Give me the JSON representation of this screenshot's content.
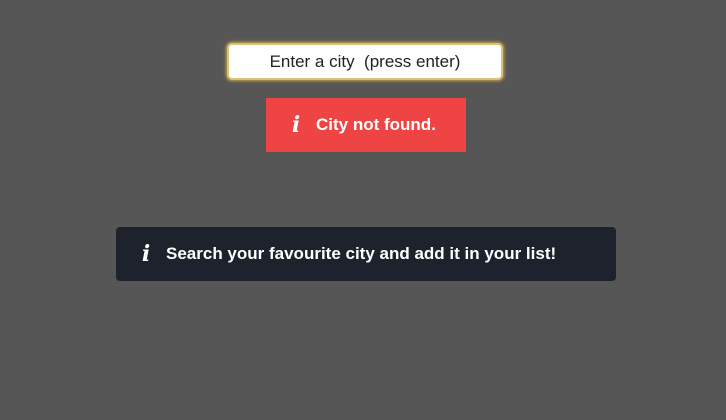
{
  "search": {
    "placeholder": "Enter a city  (press enter)",
    "value": ""
  },
  "error_alert": {
    "icon": "info-icon",
    "icon_glyph": "i",
    "message": "City not found.",
    "color": "#ef4444"
  },
  "info_alert": {
    "icon": "info-icon",
    "icon_glyph": "i",
    "message": "Search your favourite city and add it in your list!",
    "color": "#1d222c"
  },
  "colors": {
    "background": "#565656",
    "input_border": "#d8c27a"
  }
}
